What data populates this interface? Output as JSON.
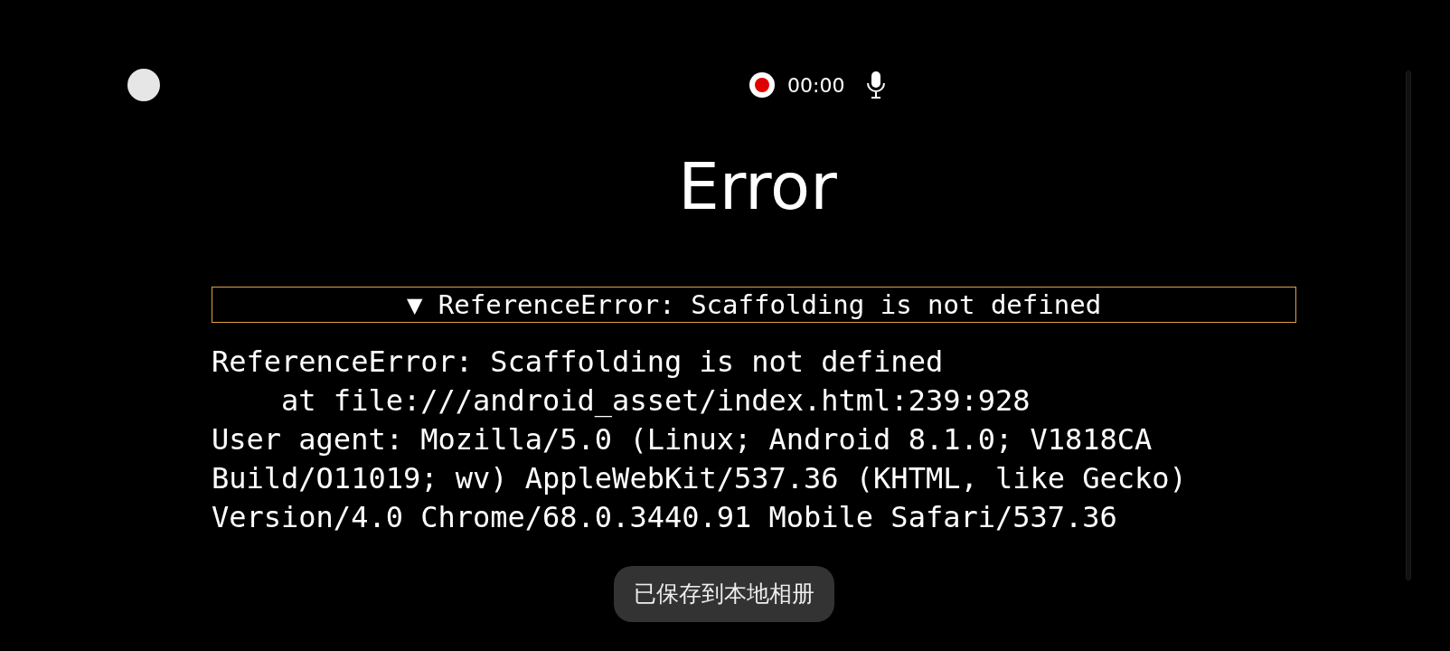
{
  "recorder": {
    "recording": true,
    "time": "00:00"
  },
  "title": "Error",
  "details": {
    "expanded": true,
    "marker": "▼",
    "summary": "ReferenceError: Scaffolding is not defined",
    "lines": [
      "ReferenceError: Scaffolding is not defined",
      "    at file:///android_asset/index.html:239:928",
      "User agent: Mozilla/5.0 (Linux; Android 8.1.0; V1818CA",
      "Build/O11019; wv) AppleWebKit/537.36 (KHTML, like Gecko)",
      "Version/4.0 Chrome/68.0.3440.91 Mobile Safari/537.36"
    ]
  },
  "toast": "已保存到本地相册"
}
